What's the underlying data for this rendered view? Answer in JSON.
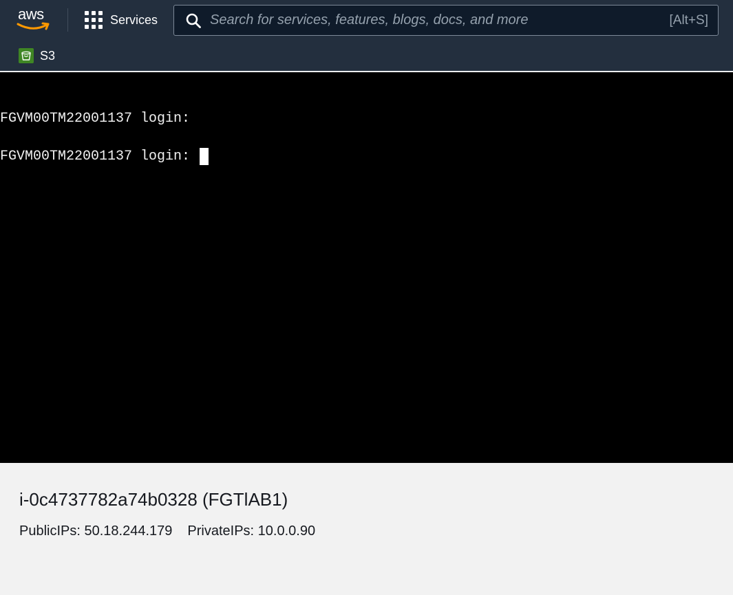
{
  "topnav": {
    "logo_text": "aws",
    "logo_icon": "aws-smile-logo",
    "services_icon": "grid-icon",
    "services_label": "Services",
    "search": {
      "icon": "search-icon",
      "placeholder": "Search for services, features, blogs, docs, and more",
      "value": "",
      "shortcut": "[Alt+S]"
    }
  },
  "favorites": {
    "items": [
      {
        "icon": "s3-bucket-icon",
        "label": "S3"
      }
    ]
  },
  "terminal": {
    "lines": [
      "FGVM00TM22001137 login:",
      "FGVM00TM22001137 login: "
    ]
  },
  "instance": {
    "title": "i-0c4737782a74b0328 (FGTlAB1)",
    "public_ips_label": "PublicIPs:",
    "public_ips": "50.18.244.179",
    "private_ips_label": "PrivateIPs:",
    "private_ips": "10.0.0.90"
  },
  "colors": {
    "nav_bg": "#232f3e",
    "search_bg": "#0f1b2a",
    "terminal_bg": "#000000",
    "info_bg": "#f2f2f2",
    "s3_green": "#3f8624",
    "aws_orange": "#ff9900"
  }
}
